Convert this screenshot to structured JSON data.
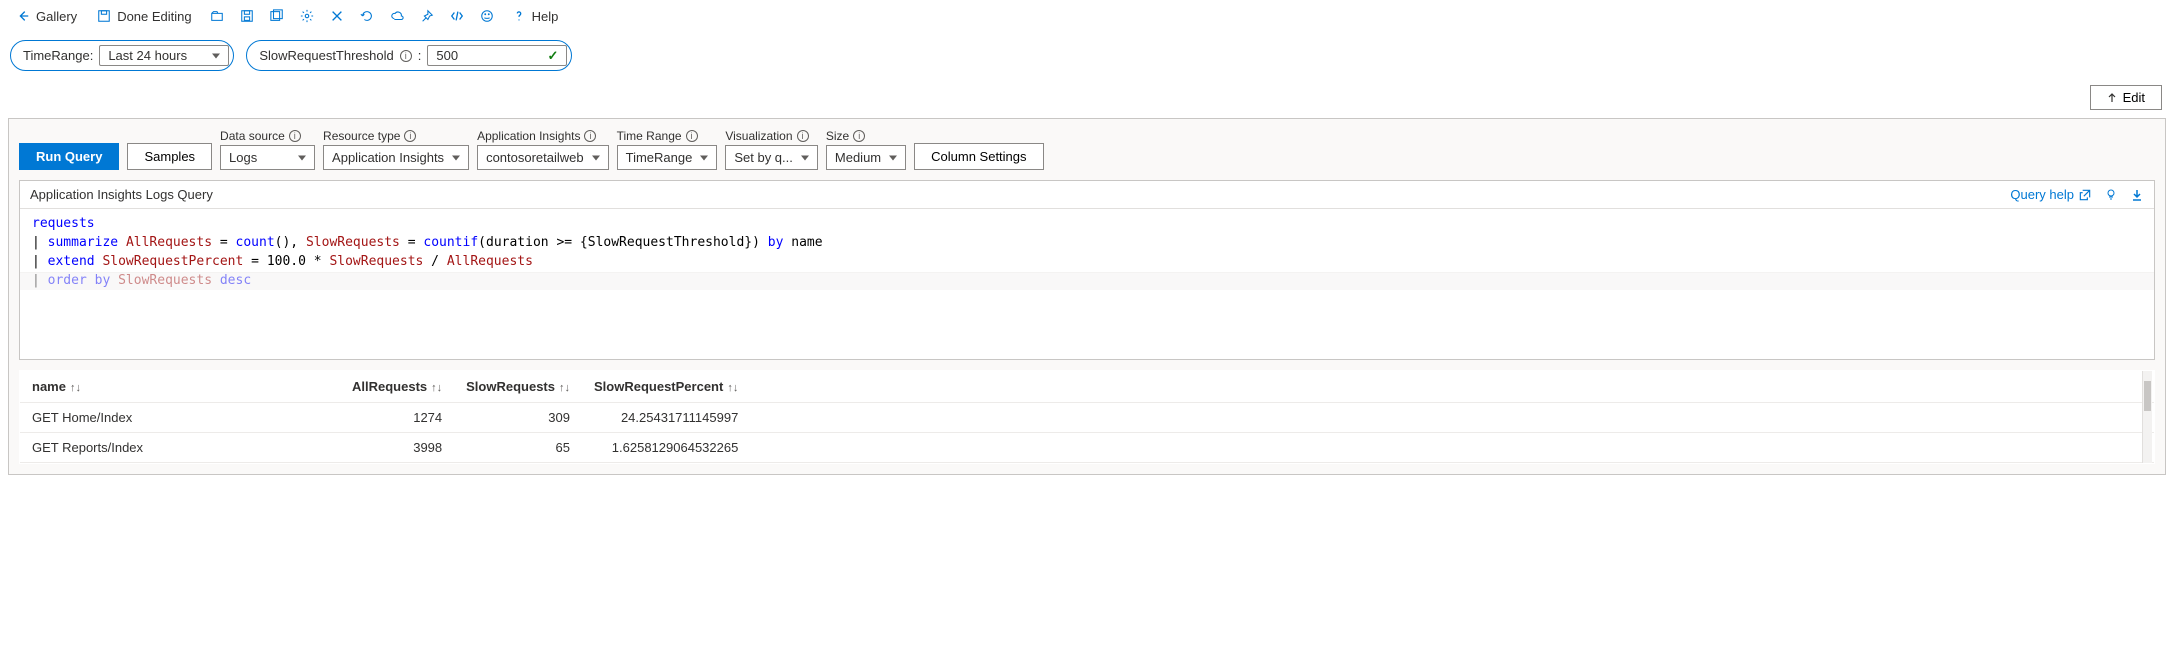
{
  "toolbar": {
    "gallery": "Gallery",
    "done_editing": "Done Editing",
    "help": "Help"
  },
  "params": {
    "timerange_label": "TimeRange:",
    "timerange_value": "Last 24 hours",
    "threshold_label": "SlowRequestThreshold",
    "threshold_sep": ":",
    "threshold_value": "500"
  },
  "edit_button": "Edit",
  "controls": {
    "run_query": "Run Query",
    "samples": "Samples",
    "data_source_label": "Data source",
    "data_source_value": "Logs",
    "resource_type_label": "Resource type",
    "resource_type_value": "Application Insights",
    "app_insights_label": "Application Insights",
    "app_insights_value": "contosoretailweb",
    "time_range_label": "Time Range",
    "time_range_value": "TimeRange",
    "visualization_label": "Visualization",
    "visualization_value": "Set by q...",
    "size_label": "Size",
    "size_value": "Medium",
    "column_settings": "Column Settings"
  },
  "panel_title": "Application Insights Logs Query",
  "query_help": "Query help",
  "query": {
    "line1_table": "requests",
    "line2_pipe": "|",
    "line2_kw": "summarize",
    "line2_id1": "AllRequests",
    "line2_eq1": " = ",
    "line2_fn1": "count",
    "line2_par1": "(), ",
    "line2_id2": "SlowRequests",
    "line2_eq2": " = ",
    "line2_fn2": "countif",
    "line2_par2": "(duration >= {SlowRequestThreshold}) ",
    "line2_by": "by",
    "line2_name": " name",
    "line3_pipe": "|",
    "line3_kw": "extend",
    "line3_id1": "SlowRequestPercent",
    "line3_eq": " = 100.0 * ",
    "line3_id2": "SlowRequests",
    "line3_div": " / ",
    "line3_id3": "AllRequests",
    "line4_pipe": "|",
    "line4_kw": "order by",
    "line4_id": "SlowRequests",
    "line4_desc": "desc"
  },
  "table": {
    "headers": {
      "name": "name",
      "all_requests": "AllRequests",
      "slow_requests": "SlowRequests",
      "slow_pct": "SlowRequestPercent"
    },
    "rows": [
      {
        "name": "GET Home/Index",
        "all": "1274",
        "slow": "309",
        "pct": "24.25431711145997"
      },
      {
        "name": "GET Reports/Index",
        "all": "3998",
        "slow": "65",
        "pct": "1.6258129064532265"
      }
    ]
  }
}
